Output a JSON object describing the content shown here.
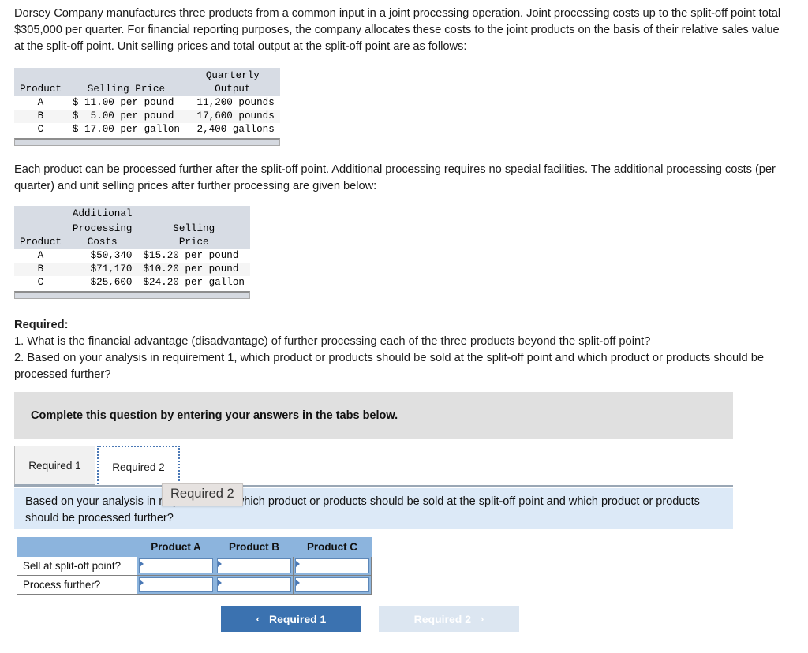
{
  "intro_paragraph": "Dorsey Company manufactures three products from a common input in a joint processing operation. Joint processing costs up to the split-off point total $305,000 per quarter. For financial reporting purposes, the company allocates these costs to the joint products on the basis of their relative sales value at the split-off point. Unit selling prices and total output at the split-off point are as follows:",
  "further_paragraph": "Each product can be processed further after the split-off point. Additional processing requires no special facilities. The additional processing costs (per quarter) and unit selling prices after further processing are given below:",
  "split_off_table": {
    "headers": {
      "product": "Product",
      "selling_price": "Selling Price",
      "quarterly": "Quarterly",
      "output": "Output"
    },
    "rows": [
      {
        "product": "A",
        "selling_price": "$ 11.00 per pound",
        "output": "11,200 pounds"
      },
      {
        "product": "B",
        "selling_price": "$  5.00 per pound",
        "output": "17,600 pounds"
      },
      {
        "product": "C",
        "selling_price": "$ 17.00 per gallon",
        "output": " 2,400 gallons"
      }
    ]
  },
  "further_table": {
    "headers": {
      "product": "Product",
      "additional": "Additional",
      "processing": "Processing",
      "costs": "Costs",
      "selling": "Selling",
      "price": "Price"
    },
    "rows": [
      {
        "product": "A",
        "cost": "$50,340",
        "price": "$15.20 per pound"
      },
      {
        "product": "B",
        "cost": "$71,170",
        "price": "$10.20 per pound"
      },
      {
        "product": "C",
        "cost": "$25,600",
        "price": "$24.20 per gallon"
      }
    ]
  },
  "required": {
    "title": "Required:",
    "item1": "1. What is the financial advantage (disadvantage) of further processing each of the three products beyond the split-off point?",
    "item2": "2. Based on your analysis in requirement 1, which product or products should be sold at the split-off point and which product or products should be processed further?"
  },
  "instruction_banner": "Complete this question by entering your answers in the tabs below.",
  "tabs": [
    {
      "label": "Required 1",
      "active": false
    },
    {
      "label": "Required 2",
      "active": true
    }
  ],
  "tooltip": "Required 2",
  "question_text": "Based on your analysis in requirement 1, which product or products should be sold at the split-off point and which product or products should be processed further?",
  "answer_grid": {
    "column_headers": [
      "Product A",
      "Product B",
      "Product C"
    ],
    "rows": [
      {
        "label": "Sell at split-off point?",
        "values": [
          "",
          "",
          ""
        ]
      },
      {
        "label": "Process further?",
        "values": [
          "",
          "",
          ""
        ]
      }
    ]
  },
  "nav": {
    "prev_label": "Required 1",
    "prev_chevron": "‹",
    "next_label": "Required 2",
    "next_chevron": "›"
  },
  "colors": {
    "primary_button": "#3b72b0",
    "disabled_button": "#dce6f1",
    "grid_header": "#8cb4dd",
    "question_box": "#dce9f7",
    "banner": "#e0e0e0",
    "mono_header": "#d7dce4"
  }
}
